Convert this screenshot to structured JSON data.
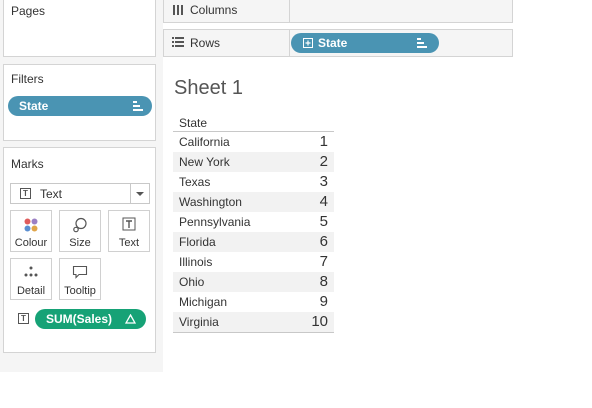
{
  "cards": {
    "pages": {
      "title": "Pages"
    },
    "filters": {
      "title": "Filters",
      "pill": "State"
    },
    "marks": {
      "title": "Marks",
      "mark_type": "Text",
      "buttons": [
        "Colour",
        "Size",
        "Text",
        "Detail",
        "Tooltip"
      ],
      "measure_pill": "SUM(Sales)",
      "measure_pill_icon": "delta-icon"
    }
  },
  "shelves": {
    "columns": {
      "label": "Columns"
    },
    "rows": {
      "label": "Rows",
      "pill": "State",
      "pill_icon": "plus-box-icon"
    }
  },
  "sheet": {
    "title": "Sheet 1",
    "column_header": "State",
    "rows": [
      {
        "state": "California",
        "value": "1"
      },
      {
        "state": "New York",
        "value": "2"
      },
      {
        "state": "Texas",
        "value": "3"
      },
      {
        "state": "Washington",
        "value": "4"
      },
      {
        "state": "Pennsylvania",
        "value": "5"
      },
      {
        "state": "Florida",
        "value": "6"
      },
      {
        "state": "Illinois",
        "value": "7"
      },
      {
        "state": "Ohio",
        "value": "8"
      },
      {
        "state": "Michigan",
        "value": "9"
      },
      {
        "state": "Virginia",
        "value": "10"
      }
    ]
  },
  "colors": {
    "dimension_pill": "#4a94b3",
    "measure_pill": "#16a276",
    "panel_bg": "#f5f5f5",
    "row_alt": "#f2f2f2"
  }
}
